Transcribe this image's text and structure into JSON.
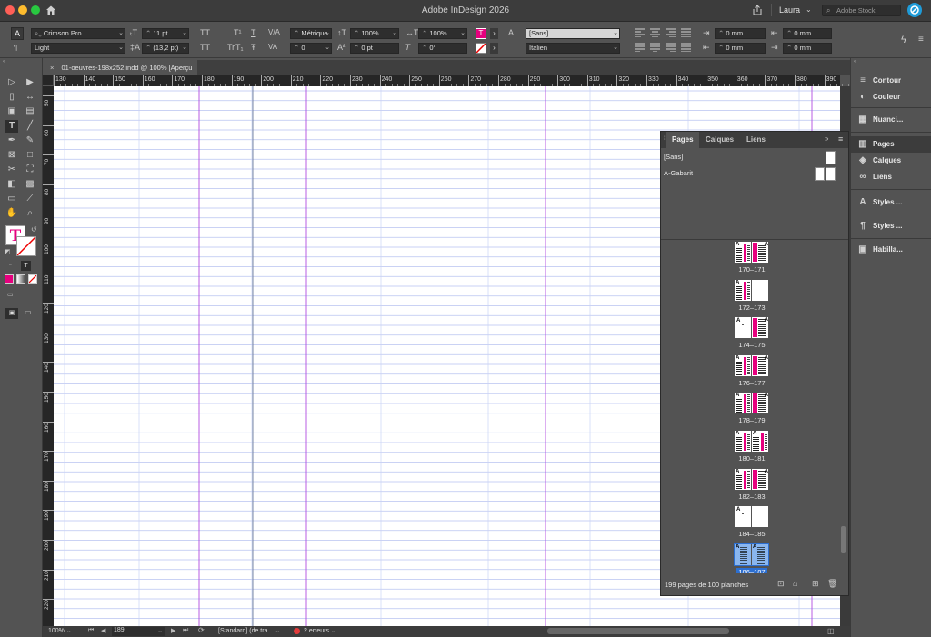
{
  "app": {
    "title": "Adobe InDesign 2026",
    "user": "Laura",
    "stock_placeholder": "Adobe Stock"
  },
  "control": {
    "font_family": "Crimson Pro",
    "font_style": "Light",
    "font_size": "11 pt",
    "leading": "(13,2 pt)",
    "kerning": "Métrique",
    "tracking": "0",
    "vscale": "100%",
    "hscale": "100%",
    "baseline": "0 pt",
    "skew": "0°",
    "char_style": "[Sans]",
    "language": "Italien",
    "indent_left": "0 mm",
    "indent_right": "0 mm",
    "indent_first": "0 mm",
    "indent_last": "0 mm",
    "tt": "TT",
    "tr": "Tr",
    "t_sup": "T¹",
    "t_sub": "T₁",
    "t_under": "T",
    "t_strike": "Ŧ"
  },
  "document": {
    "tab_label": "01-oeuvres-198x252.indd @ 100% [Aperçu GPU]"
  },
  "ruler": {
    "h_labels": [
      "130",
      "140",
      "150",
      "160",
      "170",
      "180",
      "190",
      "200",
      "210",
      "220",
      "230",
      "240",
      "250",
      "260",
      "270",
      "280",
      "290",
      "300",
      "310",
      "320",
      "330",
      "340",
      "350",
      "360",
      "370",
      "380",
      "390"
    ],
    "v_labels": [
      "50",
      "60",
      "70",
      "80",
      "90",
      "100",
      "110",
      "120",
      "130",
      "140",
      "150",
      "160",
      "170",
      "180",
      "190",
      "200",
      "210",
      "220"
    ]
  },
  "status": {
    "zoom": "100%",
    "page": "189",
    "style": "[Standard] (de tra...",
    "errors": "2 erreurs"
  },
  "dock": {
    "items": [
      {
        "label": "Contour",
        "icon": "stroke-icon"
      },
      {
        "label": "Couleur",
        "icon": "color-icon"
      },
      {
        "label": "Nuanci...",
        "icon": "swatches-icon"
      },
      {
        "label": "Pages",
        "icon": "pages-icon"
      },
      {
        "label": "Calques",
        "icon": "layers-icon"
      },
      {
        "label": "Liens",
        "icon": "links-icon"
      },
      {
        "label": "Styles ...",
        "icon": "char-styles-icon"
      },
      {
        "label": "Styles ...",
        "icon": "para-styles-icon"
      },
      {
        "label": "Habilla...",
        "icon": "wrap-icon"
      }
    ]
  },
  "pages_panel": {
    "tabs": [
      "Pages",
      "Calques",
      "Liens"
    ],
    "masters": [
      "[Sans]",
      "A-Gabarit"
    ],
    "spreads": [
      {
        "label": "170–171",
        "left": "dense",
        "right": "pink"
      },
      {
        "label": "172–173",
        "left": "dense",
        "right": "blank"
      },
      {
        "label": "174–175",
        "left": "sparse",
        "right": "pink"
      },
      {
        "label": "176–177",
        "left": "dense",
        "right": "pink"
      },
      {
        "label": "178–179",
        "left": "dense",
        "right": "pink"
      },
      {
        "label": "180–181",
        "left": "dense",
        "right": "dense"
      },
      {
        "label": "182–183",
        "left": "dense",
        "right": "pink"
      },
      {
        "label": "184–185",
        "left": "sparse",
        "right": "blank"
      },
      {
        "label": "186–187",
        "left": "selected",
        "right": "selected"
      }
    ],
    "footer": "199 pages de 100 planches"
  },
  "colors": {
    "accent": "#e6007e",
    "selection": "#2c6fd1",
    "grid": "#b9c3f0",
    "guide": "#b14be0"
  }
}
